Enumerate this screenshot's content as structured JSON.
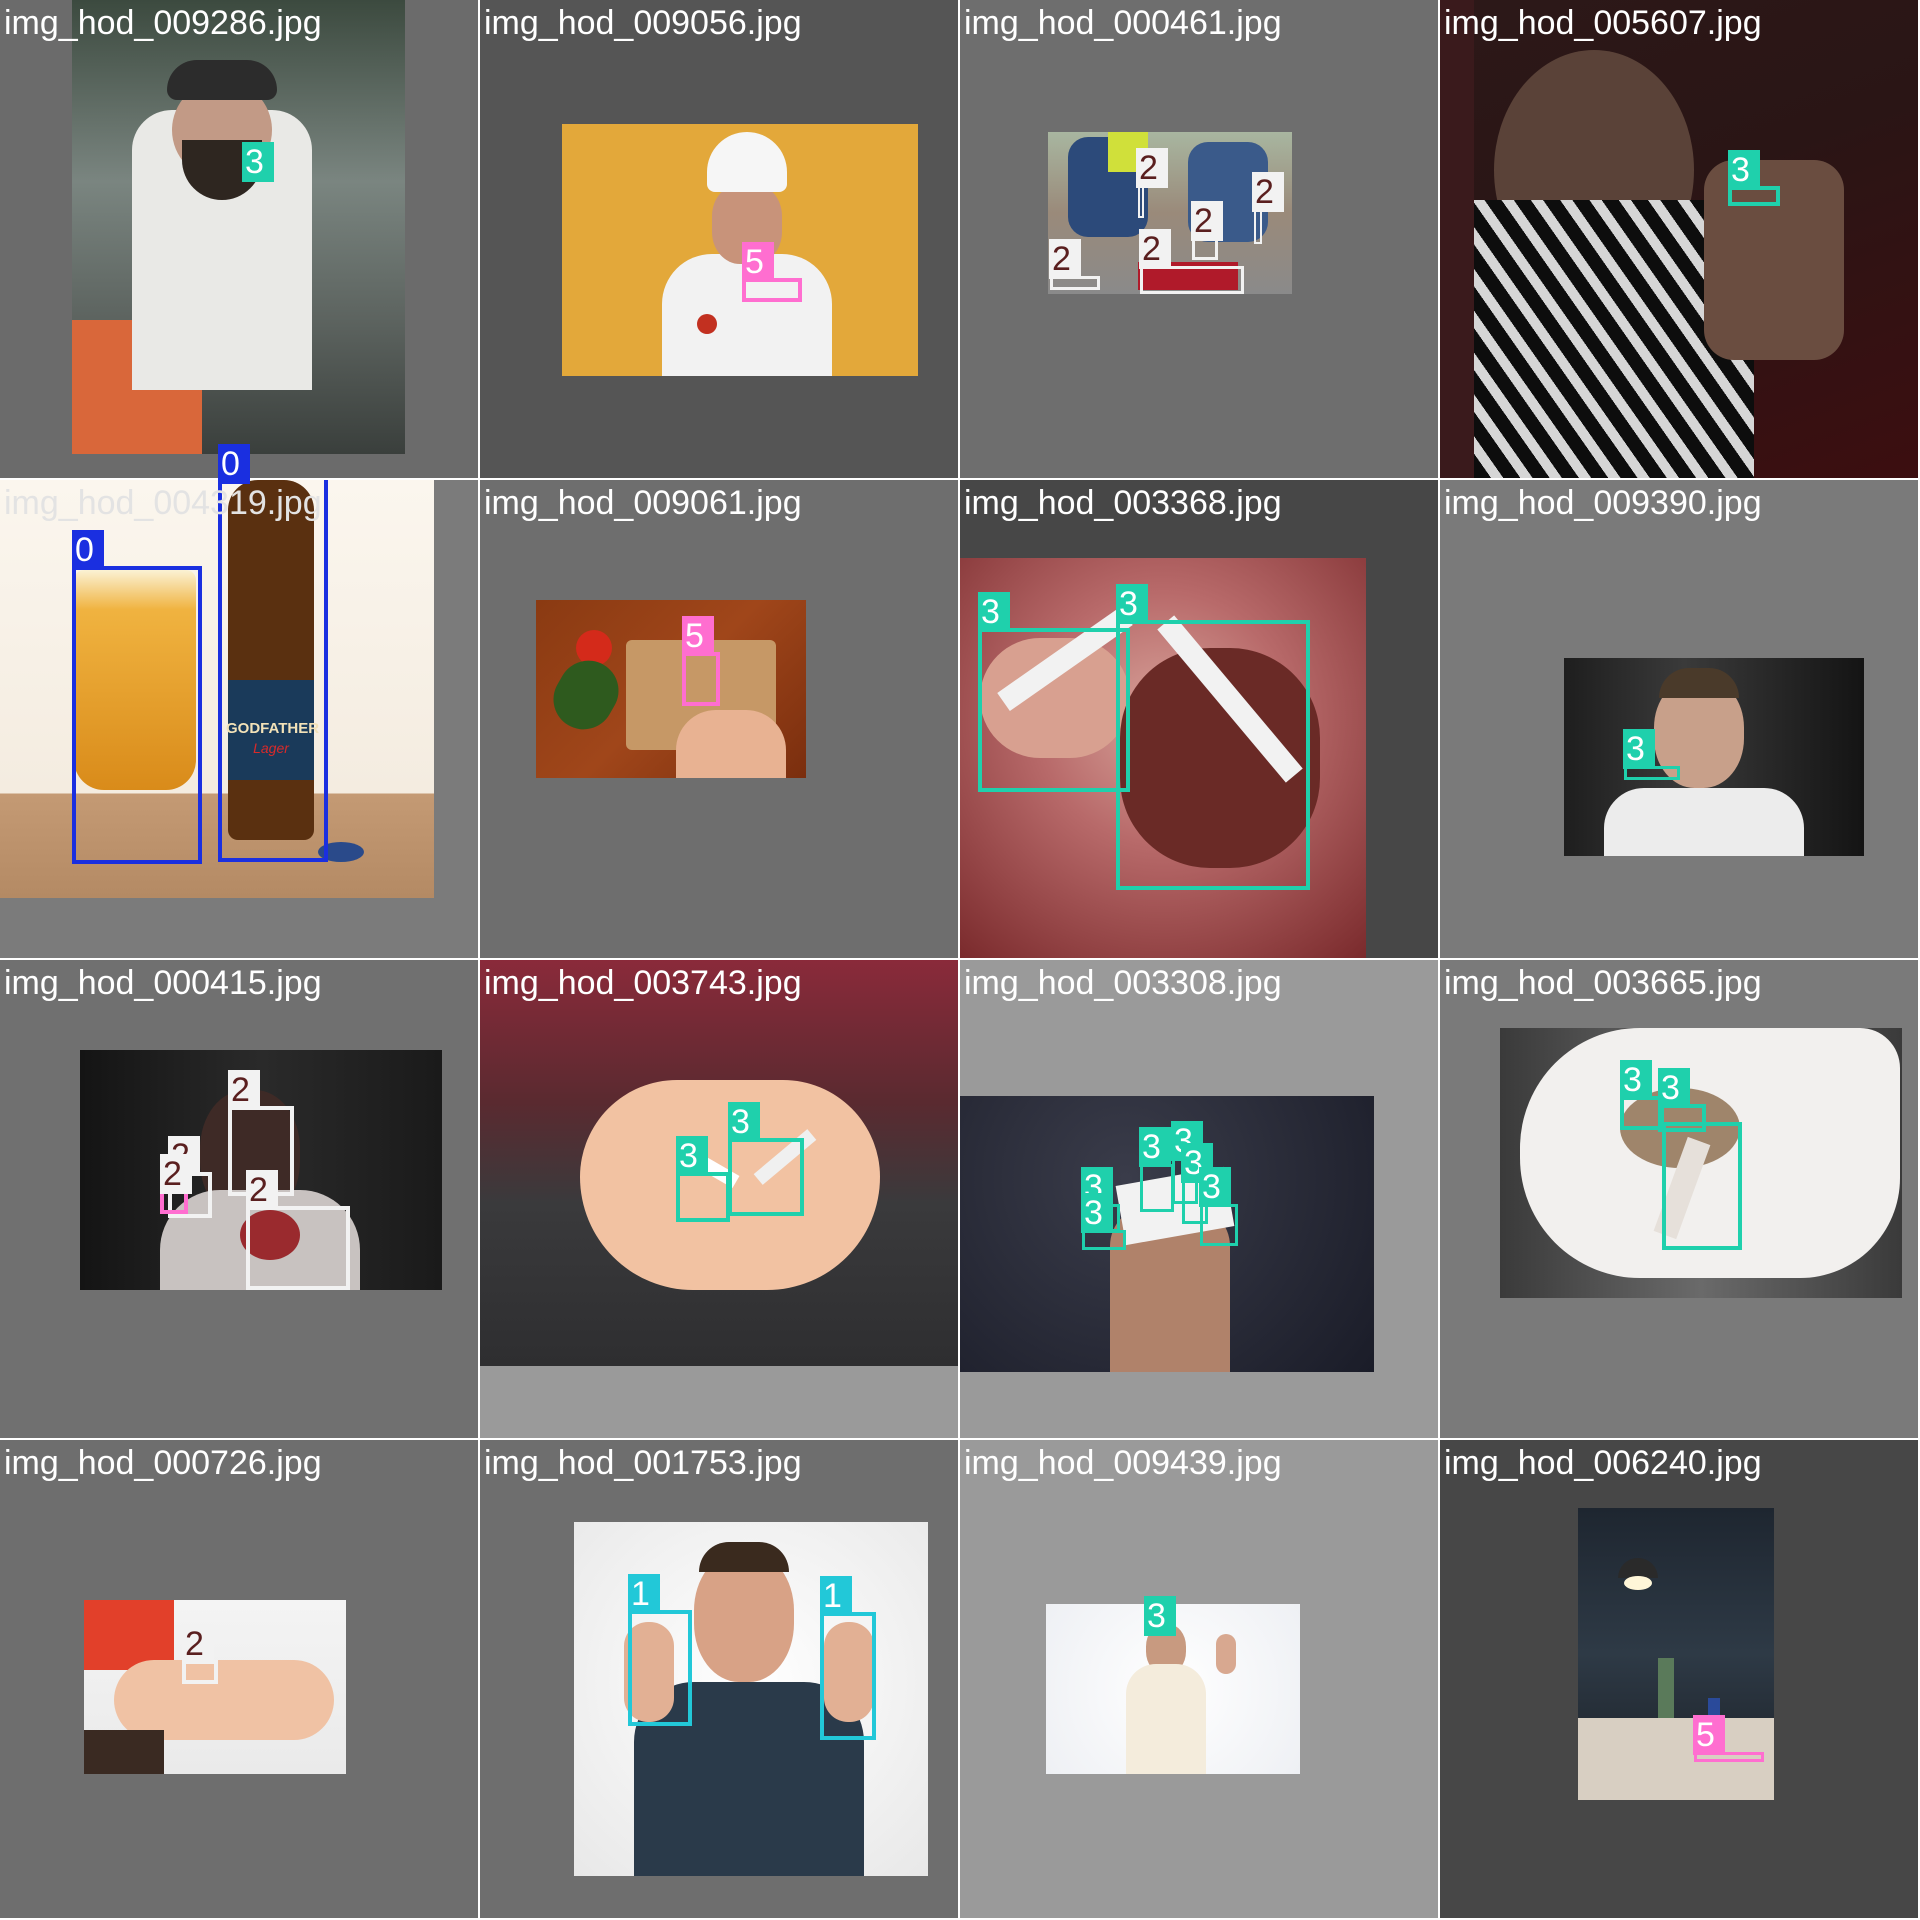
{
  "grid_title": "",
  "tiles": [
    {
      "filename": "img_hod_009286.jpg",
      "labels": [
        "3"
      ]
    },
    {
      "filename": "img_hod_009056.jpg",
      "labels": [
        "5"
      ]
    },
    {
      "filename": "img_hod_000461.jpg",
      "labels": [
        "2",
        "2",
        "2",
        "2",
        "2"
      ]
    },
    {
      "filename": "img_hod_005607.jpg",
      "labels": [
        "3"
      ]
    },
    {
      "filename": "img_hod_004319.jpg",
      "labels": [
        "0",
        "0"
      ]
    },
    {
      "filename": "img_hod_009061.jpg",
      "labels": [
        "5"
      ]
    },
    {
      "filename": "img_hod_003368.jpg",
      "labels": [
        "3",
        "3"
      ]
    },
    {
      "filename": "img_hod_009390.jpg",
      "labels": [
        "3"
      ]
    },
    {
      "filename": "img_hod_000415.jpg",
      "labels": [
        "2",
        "2",
        "2",
        "2"
      ]
    },
    {
      "filename": "img_hod_003743.jpg",
      "labels": [
        "3",
        "3"
      ]
    },
    {
      "filename": "img_hod_003308.jpg",
      "labels": [
        "3",
        "3",
        "3",
        "3",
        "3",
        "3"
      ]
    },
    {
      "filename": "img_hod_003665.jpg",
      "labels": [
        "3",
        "3",
        "3"
      ]
    },
    {
      "filename": "img_hod_000726.jpg",
      "labels": [
        "2"
      ]
    },
    {
      "filename": "img_hod_001753.jpg",
      "labels": [
        "1",
        "1"
      ]
    },
    {
      "filename": "img_hod_009439.jpg",
      "labels": [
        "3"
      ]
    },
    {
      "filename": "img_hod_006240.jpg",
      "labels": [
        "5"
      ]
    }
  ],
  "class_colors": {
    "0": "#1a2fe0",
    "1": "#22c8d8",
    "2": "#f2f2f2",
    "3": "#1fd0ac",
    "5": "#ff6ed0"
  },
  "photo_text": {
    "beer_brand": "GODFATHER",
    "beer_sub": "Lager"
  }
}
